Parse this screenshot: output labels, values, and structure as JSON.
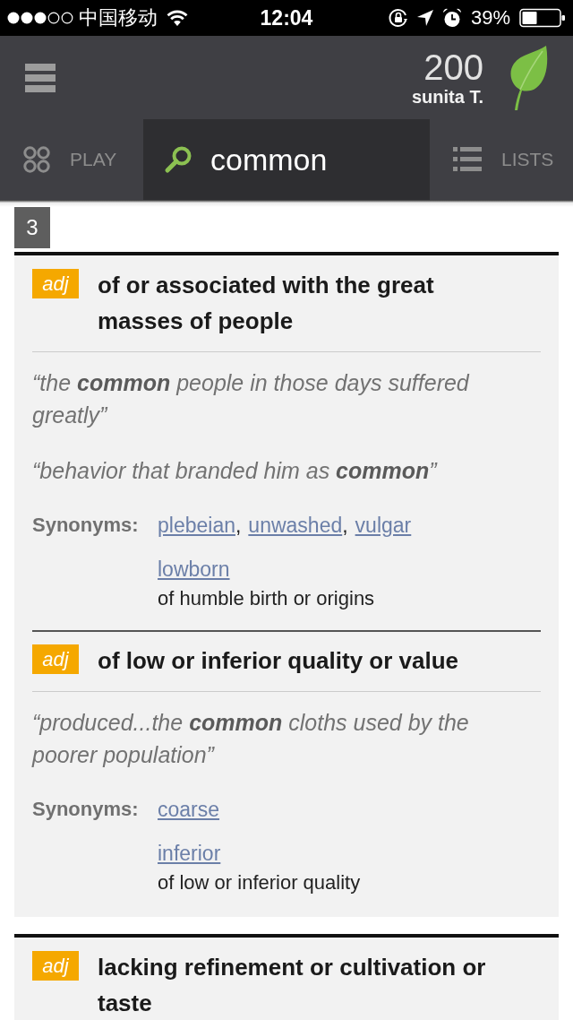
{
  "status_bar": {
    "carrier": "中国移动",
    "time": "12:04",
    "battery": "39%"
  },
  "header": {
    "score": "200",
    "user_name": "sunita T."
  },
  "tabs": [
    {
      "kind": "play",
      "label": "PLAY",
      "selected": false
    },
    {
      "kind": "search",
      "label": "common",
      "selected": true
    },
    {
      "kind": "lists",
      "label": "LISTS",
      "selected": false
    }
  ],
  "entry": {
    "number": "3",
    "synonym_separator": ",",
    "blocks": [
      {
        "senses": [
          {
            "part_of_speech": "adj",
            "definition": "of or associated with the great masses of people",
            "examples": [
              "“the **common** people in those days suffered greatly”",
              "“behavior that branded him as **common**”"
            ],
            "synonyms_label": "Synonyms:",
            "synonym_groups": [
              {
                "words": [
                  "plebeian",
                  "unwashed",
                  "vulgar"
                ]
              },
              {
                "words": [
                  "lowborn"
                ],
                "gloss": "of humble birth or origins"
              }
            ]
          },
          {
            "part_of_speech": "adj",
            "definition": "of low or inferior quality or value",
            "examples": [
              "“produced...the **common** cloths used by the poorer population”"
            ],
            "synonyms_label": "Synonyms:",
            "synonym_groups": [
              {
                "words": [
                  "coarse"
                ]
              },
              {
                "words": [
                  "inferior"
                ],
                "gloss": "of low or inferior quality"
              }
            ]
          }
        ]
      },
      {
        "senses": [
          {
            "part_of_speech": "adj",
            "definition": "lacking refinement or cultivation or taste"
          }
        ]
      }
    ]
  }
}
